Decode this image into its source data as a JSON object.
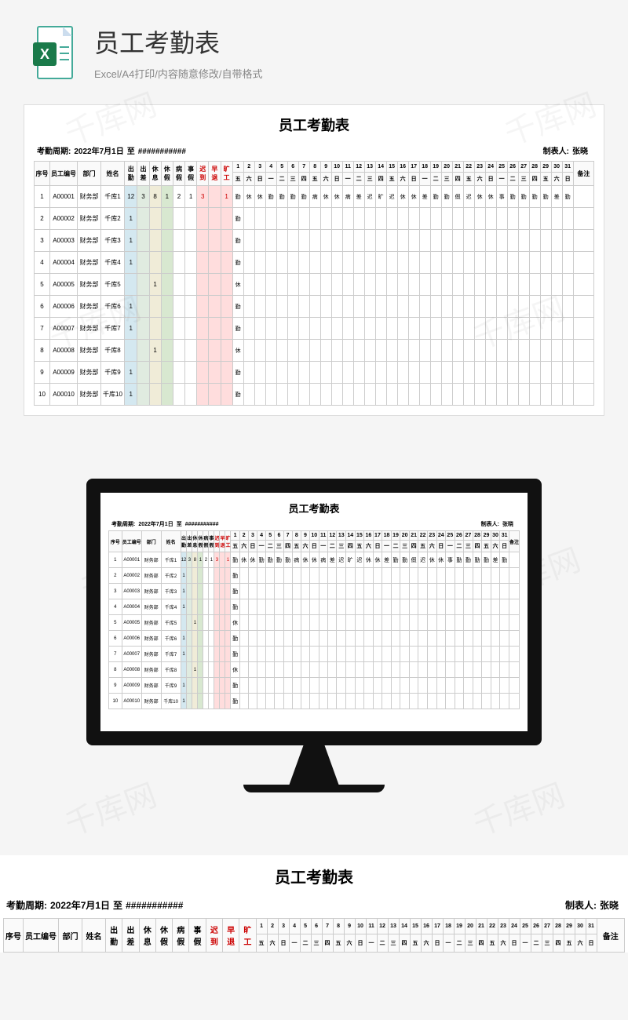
{
  "header": {
    "title": "员工考勤表",
    "subtitle": "Excel/A4打印/内容随意修改/自带格式"
  },
  "sheet": {
    "title": "员工考勤表",
    "period_label": "考勤周期:",
    "period_start": "2022年7月1日",
    "period_to": "至",
    "period_end": "###########",
    "creator_label": "制表人:",
    "creator_name": "张晓",
    "headers": {
      "seq": "序号",
      "emp_id": "员工编号",
      "dept": "部门",
      "name": "姓名",
      "remark": "备注",
      "totals": [
        "出勤",
        "出差",
        "休息",
        "休假",
        "病假",
        "事假",
        "迟到",
        "早退",
        "旷工"
      ]
    },
    "days_num": [
      "1",
      "2",
      "3",
      "4",
      "5",
      "6",
      "7",
      "8",
      "9",
      "10",
      "11",
      "12",
      "13",
      "14",
      "15",
      "16",
      "17",
      "18",
      "19",
      "20",
      "21",
      "22",
      "23",
      "24",
      "25",
      "26",
      "27",
      "28",
      "29",
      "30",
      "31"
    ],
    "days_wk": [
      "五",
      "六",
      "日",
      "一",
      "二",
      "三",
      "四",
      "五",
      "六",
      "日",
      "一",
      "二",
      "三",
      "四",
      "五",
      "六",
      "日",
      "一",
      "二",
      "三",
      "四",
      "五",
      "六",
      "日",
      "一",
      "二",
      "三",
      "四",
      "五",
      "六",
      "日"
    ],
    "rows": [
      {
        "seq": "1",
        "emp": "A00001",
        "dept": "财务部",
        "name": "千库1",
        "tot": [
          "12",
          "3",
          "8",
          "1",
          "2",
          "1",
          "3",
          "",
          "1"
        ],
        "d": [
          "勤",
          "休",
          "休",
          "勤",
          "勤",
          "勤",
          "勤",
          "病",
          "休",
          "休",
          "病",
          "差",
          "迟",
          "旷",
          "迟",
          "休",
          "休",
          "差",
          "勤",
          "勤",
          "假",
          "迟",
          "休",
          "休",
          "事",
          "勤",
          "勤",
          "勤",
          "勤",
          "差",
          "勤"
        ]
      },
      {
        "seq": "2",
        "emp": "A00002",
        "dept": "财务部",
        "name": "千库2",
        "tot": [
          "1",
          "",
          "",
          "",
          "",
          "",
          "",
          "",
          ""
        ],
        "d": [
          "勤",
          "",
          "",
          "",
          "",
          "",
          "",
          "",
          "",
          "",
          "",
          "",
          "",
          "",
          "",
          "",
          "",
          "",
          "",
          "",
          "",
          "",
          "",
          "",
          "",
          "",
          "",
          "",
          "",
          "",
          ""
        ]
      },
      {
        "seq": "3",
        "emp": "A00003",
        "dept": "财务部",
        "name": "千库3",
        "tot": [
          "1",
          "",
          "",
          "",
          "",
          "",
          "",
          "",
          ""
        ],
        "d": [
          "勤",
          "",
          "",
          "",
          "",
          "",
          "",
          "",
          "",
          "",
          "",
          "",
          "",
          "",
          "",
          "",
          "",
          "",
          "",
          "",
          "",
          "",
          "",
          "",
          "",
          "",
          "",
          "",
          "",
          "",
          ""
        ]
      },
      {
        "seq": "4",
        "emp": "A00004",
        "dept": "财务部",
        "name": "千库4",
        "tot": [
          "1",
          "",
          "",
          "",
          "",
          "",
          "",
          "",
          ""
        ],
        "d": [
          "勤",
          "",
          "",
          "",
          "",
          "",
          "",
          "",
          "",
          "",
          "",
          "",
          "",
          "",
          "",
          "",
          "",
          "",
          "",
          "",
          "",
          "",
          "",
          "",
          "",
          "",
          "",
          "",
          "",
          "",
          ""
        ]
      },
      {
        "seq": "5",
        "emp": "A00005",
        "dept": "财务部",
        "name": "千库5",
        "tot": [
          "",
          "",
          "1",
          "",
          "",
          "",
          "",
          "",
          ""
        ],
        "d": [
          "休",
          "",
          "",
          "",
          "",
          "",
          "",
          "",
          "",
          "",
          "",
          "",
          "",
          "",
          "",
          "",
          "",
          "",
          "",
          "",
          "",
          "",
          "",
          "",
          "",
          "",
          "",
          "",
          "",
          "",
          ""
        ]
      },
      {
        "seq": "6",
        "emp": "A00006",
        "dept": "财务部",
        "name": "千库6",
        "tot": [
          "1",
          "",
          "",
          "",
          "",
          "",
          "",
          "",
          ""
        ],
        "d": [
          "勤",
          "",
          "",
          "",
          "",
          "",
          "",
          "",
          "",
          "",
          "",
          "",
          "",
          "",
          "",
          "",
          "",
          "",
          "",
          "",
          "",
          "",
          "",
          "",
          "",
          "",
          "",
          "",
          "",
          "",
          ""
        ]
      },
      {
        "seq": "7",
        "emp": "A00007",
        "dept": "财务部",
        "name": "千库7",
        "tot": [
          "1",
          "",
          "",
          "",
          "",
          "",
          "",
          "",
          ""
        ],
        "d": [
          "勤",
          "",
          "",
          "",
          "",
          "",
          "",
          "",
          "",
          "",
          "",
          "",
          "",
          "",
          "",
          "",
          "",
          "",
          "",
          "",
          "",
          "",
          "",
          "",
          "",
          "",
          "",
          "",
          "",
          "",
          ""
        ]
      },
      {
        "seq": "8",
        "emp": "A00008",
        "dept": "财务部",
        "name": "千库8",
        "tot": [
          "",
          "",
          "1",
          "",
          "",
          "",
          "",
          "",
          ""
        ],
        "d": [
          "休",
          "",
          "",
          "",
          "",
          "",
          "",
          "",
          "",
          "",
          "",
          "",
          "",
          "",
          "",
          "",
          "",
          "",
          "",
          "",
          "",
          "",
          "",
          "",
          "",
          "",
          "",
          "",
          "",
          "",
          ""
        ]
      },
      {
        "seq": "9",
        "emp": "A00009",
        "dept": "财务部",
        "name": "千库9",
        "tot": [
          "1",
          "",
          "",
          "",
          "",
          "",
          "",
          "",
          ""
        ],
        "d": [
          "勤",
          "",
          "",
          "",
          "",
          "",
          "",
          "",
          "",
          "",
          "",
          "",
          "",
          "",
          "",
          "",
          "",
          "",
          "",
          "",
          "",
          "",
          "",
          "",
          "",
          "",
          "",
          "",
          "",
          "",
          ""
        ]
      },
      {
        "seq": "10",
        "emp": "A00010",
        "dept": "财务部",
        "name": "千库10",
        "tot": [
          "1",
          "",
          "",
          "",
          "",
          "",
          "",
          "",
          ""
        ],
        "d": [
          "勤",
          "",
          "",
          "",
          "",
          "",
          "",
          "",
          "",
          "",
          "",
          "",
          "",
          "",
          "",
          "",
          "",
          "",
          "",
          "",
          "",
          "",
          "",
          "",
          "",
          "",
          "",
          "",
          "",
          "",
          ""
        ]
      }
    ]
  },
  "watermark": "千库网"
}
